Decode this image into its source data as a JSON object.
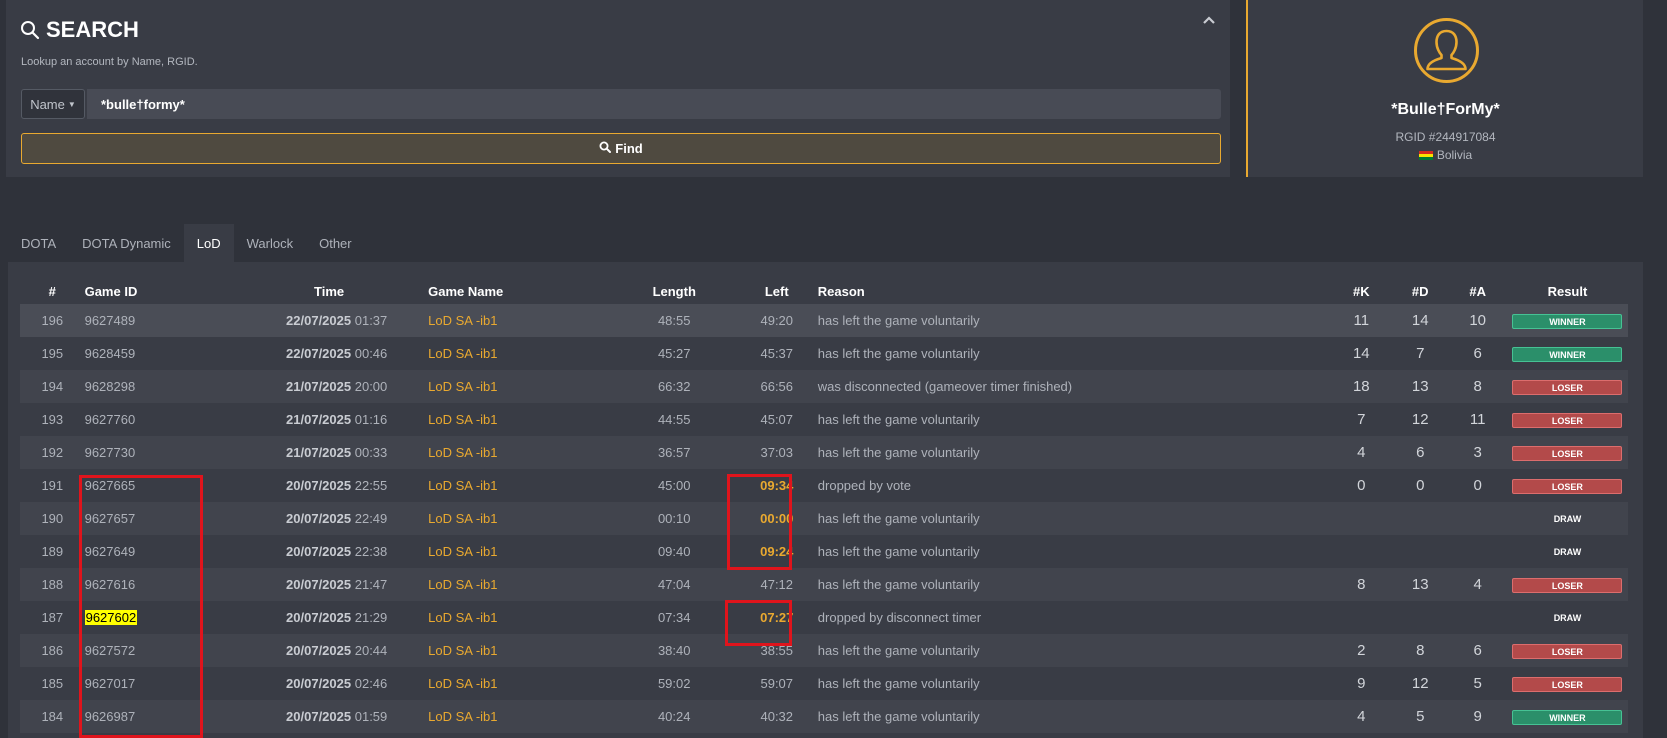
{
  "search": {
    "title": "SEARCH",
    "subtitle": "Lookup an account by Name, RGID.",
    "field_type": "Name",
    "query": "*bulle†formy*",
    "find_label": "Find"
  },
  "profile": {
    "name": "*Bulle†ForMy*",
    "rgid": "RGID #244917084",
    "country": "Bolivia"
  },
  "tabs": [
    "DOTA",
    "DOTA Dynamic",
    "LoD",
    "Warlock",
    "Other"
  ],
  "active_tab": "LoD",
  "table": {
    "headers": [
      "#",
      "Game ID",
      "Time",
      "Game Name",
      "Length",
      "Left",
      "Reason",
      "#K",
      "#D",
      "#A",
      "Result"
    ],
    "rows": [
      {
        "n": "196",
        "id": "9627489",
        "date": "22/07/2025",
        "time": "01:37",
        "name": "LoD SA -ib1",
        "length": "48:55",
        "left": "49:20",
        "reason": "has left the game voluntarily",
        "k": "11",
        "d": "14",
        "a": "10",
        "result": "WINNER"
      },
      {
        "n": "195",
        "id": "9628459",
        "date": "22/07/2025",
        "time": "00:46",
        "name": "LoD SA -ib1",
        "length": "45:27",
        "left": "45:37",
        "reason": "has left the game voluntarily",
        "k": "14",
        "d": "7",
        "a": "6",
        "result": "WINNER"
      },
      {
        "n": "194",
        "id": "9628298",
        "date": "21/07/2025",
        "time": "20:00",
        "name": "LoD SA -ib1",
        "length": "66:32",
        "left": "66:56",
        "reason": "was disconnected (gameover timer finished)",
        "k": "18",
        "d": "13",
        "a": "8",
        "result": "LOSER"
      },
      {
        "n": "193",
        "id": "9627760",
        "date": "21/07/2025",
        "time": "01:16",
        "name": "LoD SA -ib1",
        "length": "44:55",
        "left": "45:07",
        "reason": "has left the game voluntarily",
        "k": "7",
        "d": "12",
        "a": "11",
        "result": "LOSER"
      },
      {
        "n": "192",
        "id": "9627730",
        "date": "21/07/2025",
        "time": "00:33",
        "name": "LoD SA -ib1",
        "length": "36:57",
        "left": "37:03",
        "reason": "has left the game voluntarily",
        "k": "4",
        "d": "6",
        "a": "3",
        "result": "LOSER"
      },
      {
        "n": "191",
        "id": "9627665",
        "date": "20/07/2025",
        "time": "22:55",
        "name": "LoD SA -ib1",
        "length": "45:00",
        "left": "09:34",
        "reason": "dropped by vote",
        "k": "0",
        "d": "0",
        "a": "0",
        "result": "LOSER"
      },
      {
        "n": "190",
        "id": "9627657",
        "date": "20/07/2025",
        "time": "22:49",
        "name": "LoD SA -ib1",
        "length": "00:10",
        "left": "00:00",
        "reason": "has left the game voluntarily",
        "k": "",
        "d": "",
        "a": "",
        "result": "DRAW"
      },
      {
        "n": "189",
        "id": "9627649",
        "date": "20/07/2025",
        "time": "22:38",
        "name": "LoD SA -ib1",
        "length": "09:40",
        "left": "09:24",
        "reason": "has left the game voluntarily",
        "k": "",
        "d": "",
        "a": "",
        "result": "DRAW"
      },
      {
        "n": "188",
        "id": "9627616",
        "date": "20/07/2025",
        "time": "21:47",
        "name": "LoD SA -ib1",
        "length": "47:04",
        "left": "47:12",
        "reason": "has left the game voluntarily",
        "k": "8",
        "d": "13",
        "a": "4",
        "result": "LOSER"
      },
      {
        "n": "187",
        "id": "9627602",
        "date": "20/07/2025",
        "time": "21:29",
        "name": "LoD SA -ib1",
        "length": "07:34",
        "left": "07:27",
        "reason": "dropped by disconnect timer",
        "k": "",
        "d": "",
        "a": "",
        "result": "DRAW"
      },
      {
        "n": "186",
        "id": "9627572",
        "date": "20/07/2025",
        "time": "20:44",
        "name": "LoD SA -ib1",
        "length": "38:40",
        "left": "38:55",
        "reason": "has left the game voluntarily",
        "k": "2",
        "d": "8",
        "a": "6",
        "result": "LOSER"
      },
      {
        "n": "185",
        "id": "9627017",
        "date": "20/07/2025",
        "time": "02:46",
        "name": "LoD SA -ib1",
        "length": "59:02",
        "left": "59:07",
        "reason": "has left the game voluntarily",
        "k": "9",
        "d": "12",
        "a": "5",
        "result": "LOSER"
      },
      {
        "n": "184",
        "id": "9626987",
        "date": "20/07/2025",
        "time": "01:59",
        "name": "LoD SA -ib1",
        "length": "40:24",
        "left": "40:32",
        "reason": "has left the game voluntarily",
        "k": "4",
        "d": "5",
        "a": "9",
        "result": "WINNER"
      }
    ]
  },
  "colors": {
    "accent": "#e9a930",
    "winner": "#2b8f6a",
    "loser": "#b34a4a",
    "annotation": "#e0141c",
    "highlight": "#ffff00"
  }
}
